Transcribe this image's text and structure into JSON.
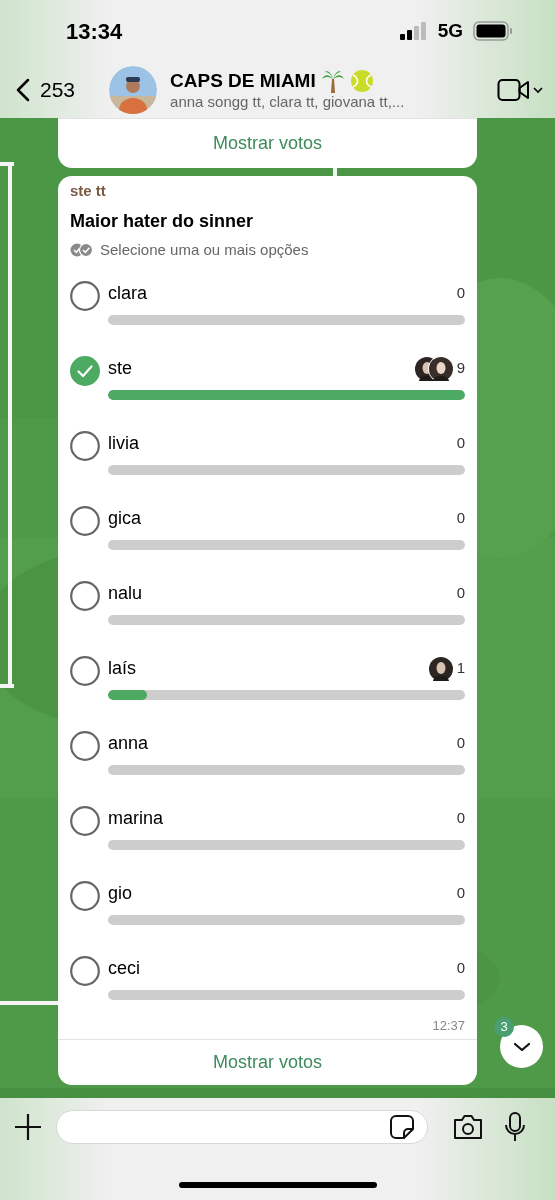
{
  "status_bar": {
    "time": "13:34",
    "network": "5G"
  },
  "header": {
    "back_count": "253",
    "title": "CAPS DE MIAMI",
    "members": "anna songg tt, clara tt, giovana tt,..."
  },
  "previous_message": {
    "show_votes": "Mostrar votos"
  },
  "poll": {
    "sender": "ste tt",
    "question": "Maior hater do sinner",
    "hint": "Selecione uma ou mais opções",
    "options": [
      {
        "label": "clara",
        "votes": "0",
        "selected": false,
        "level": 0
      },
      {
        "label": "ste",
        "votes": "9",
        "selected": true,
        "level": 1,
        "voters": [
          {
            "kind": "picture"
          },
          {
            "kind": "picture"
          }
        ]
      },
      {
        "label": "livia",
        "votes": "0",
        "selected": false,
        "level": 0
      },
      {
        "label": "gica",
        "votes": "0",
        "selected": false,
        "level": 0
      },
      {
        "label": "nalu",
        "votes": "0",
        "selected": false,
        "level": 0
      },
      {
        "label": "laís",
        "votes": "1",
        "selected": false,
        "level": 0.11,
        "voters": [
          {
            "kind": "picture"
          }
        ]
      },
      {
        "label": "anna",
        "votes": "0",
        "selected": false,
        "level": 0
      },
      {
        "label": "marina",
        "votes": "0",
        "selected": false,
        "level": 0
      },
      {
        "label": "gio",
        "votes": "0",
        "selected": false,
        "level": 0
      },
      {
        "label": "ceci",
        "votes": "0",
        "selected": false,
        "level": 0
      }
    ],
    "time": "12:37",
    "show_votes": "Mostrar votos"
  },
  "scroll_button": {
    "unread": "3"
  }
}
